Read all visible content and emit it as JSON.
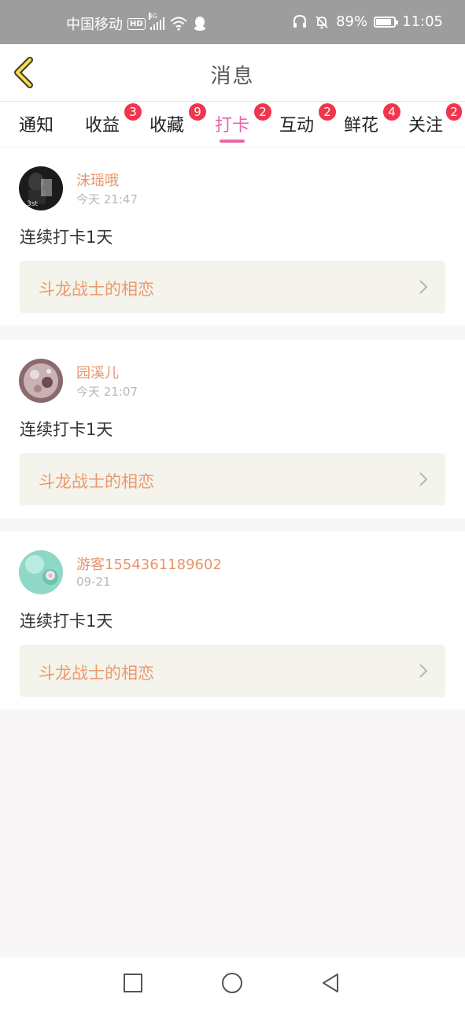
{
  "status_bar": {
    "carrier": "中国移动",
    "hd": "HD",
    "network": "4G",
    "battery": "89%",
    "time": "11:05"
  },
  "header": {
    "title": "消息"
  },
  "tabs": [
    {
      "label": "通知",
      "badge": ""
    },
    {
      "label": "收益",
      "badge": "3"
    },
    {
      "label": "收藏",
      "badge": "9"
    },
    {
      "label": "打卡",
      "badge": "2"
    },
    {
      "label": "互动",
      "badge": "2"
    },
    {
      "label": "鲜花",
      "badge": "4"
    },
    {
      "label": "关注",
      "badge": "2"
    }
  ],
  "active_tab": "打卡",
  "messages": [
    {
      "username": "沫瑶哦",
      "time": "今天 21:47",
      "text": "连续打卡1天",
      "link": "斗龙战士的相恋"
    },
    {
      "username": "园溪儿",
      "time": "今天 21:07",
      "text": "连续打卡1天",
      "link": "斗龙战士的相恋"
    },
    {
      "username": "游客1554361189602",
      "time": "09-21",
      "text": "连续打卡1天",
      "link": "斗龙战士的相恋"
    }
  ],
  "colors": {
    "accent": "#e866a8",
    "badge": "#f0354d",
    "username": "#e8956a",
    "link_text": "#ec9a6c",
    "link_bg": "#f4f3ec"
  },
  "icons": {
    "back": "chevron-left-icon",
    "chevron": "chevron-right-icon",
    "nav_recent": "square-icon",
    "nav_home": "circle-icon",
    "nav_back": "triangle-back-icon"
  }
}
